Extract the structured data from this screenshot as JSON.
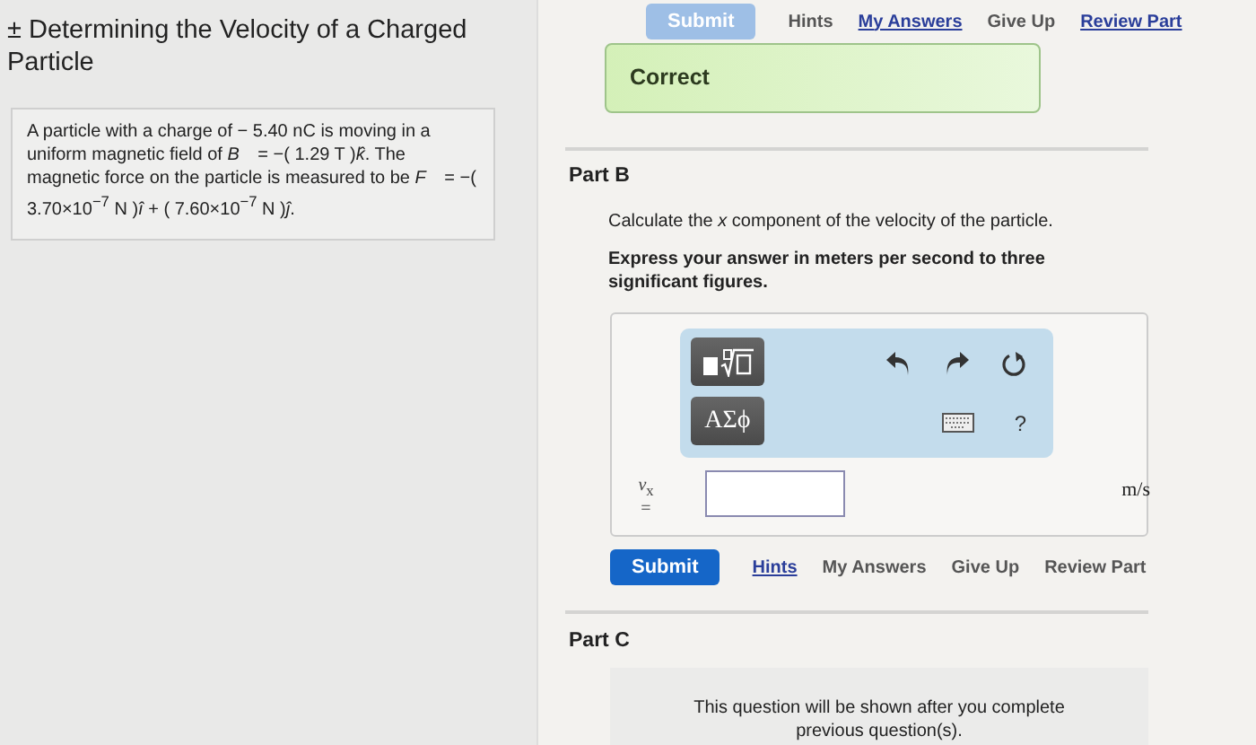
{
  "problem": {
    "title": "± Determining the Velocity of a Charged Particle",
    "statement": "A particle with a charge of − 5.40 nC is moving in a uniform magnetic field of *B⃗* = −( 1.29 T )*k̂*. The magnetic force on the particle is measured to be *F⃗* = −( 3.70×10$^{−7}$ N )*î* + ( 7.60×10$^{−7}$ N )*ĵ*."
  },
  "previous_part": {
    "actions": [
      {
        "kind": "submit",
        "label": "Submit",
        "disabled": true
      },
      {
        "kind": "link",
        "label": "Hints",
        "enabled": false
      },
      {
        "kind": "link",
        "label": "My Answers",
        "enabled": true
      },
      {
        "kind": "link",
        "label": "Give Up",
        "enabled": false
      },
      {
        "kind": "link",
        "label": "Review Part",
        "enabled": true
      }
    ],
    "feedback": "Correct"
  },
  "part_b": {
    "heading": "Part B",
    "question": "Calculate the *x* component of the velocity of the particle.",
    "instruction": "Express your answer in meters per second to three significant figures.",
    "toolbar": {
      "symbols_button": "ΑΣϕ",
      "help": "?"
    },
    "answer": {
      "variable": "*v*$_{x}$",
      "equals": "=",
      "unit": "m/s"
    },
    "actions": [
      {
        "kind": "submit",
        "label": "Submit",
        "disabled": false
      },
      {
        "kind": "link",
        "label": "Hints",
        "enabled": true
      },
      {
        "kind": "link",
        "label": "My Answers",
        "enabled": false
      },
      {
        "kind": "link",
        "label": "Give Up",
        "enabled": false
      },
      {
        "kind": "link",
        "label": "Review Part",
        "enabled": false
      }
    ]
  },
  "part_c": {
    "heading": "Part C",
    "locked_message": "This question will be shown after you complete previous question(s)."
  }
}
